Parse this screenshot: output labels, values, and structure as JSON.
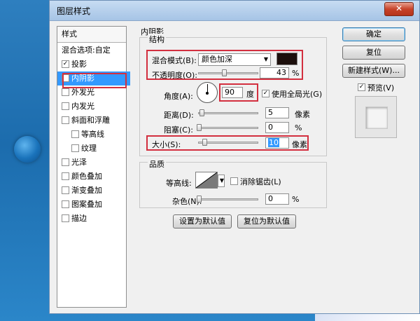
{
  "window": {
    "title": "图层样式",
    "close_glyph": "✕"
  },
  "styles": {
    "header": "样式",
    "items": [
      {
        "label": "混合选项:自定",
        "checkbox": false,
        "checked": false
      },
      {
        "label": "投影",
        "checkbox": true,
        "checked": true
      },
      {
        "label": "内阴影",
        "checkbox": true,
        "checked": true,
        "selected": true
      },
      {
        "label": "外发光",
        "checkbox": true,
        "checked": false
      },
      {
        "label": "内发光",
        "checkbox": true,
        "checked": false
      },
      {
        "label": "斜面和浮雕",
        "checkbox": true,
        "checked": false
      },
      {
        "label": "等高线",
        "checkbox": true,
        "checked": false,
        "sub": true
      },
      {
        "label": "纹理",
        "checkbox": true,
        "checked": false,
        "sub": true
      },
      {
        "label": "光泽",
        "checkbox": true,
        "checked": false
      },
      {
        "label": "颜色叠加",
        "checkbox": true,
        "checked": false
      },
      {
        "label": "渐变叠加",
        "checkbox": true,
        "checked": false
      },
      {
        "label": "图案叠加",
        "checkbox": true,
        "checked": false
      },
      {
        "label": "描边",
        "checkbox": true,
        "checked": false
      }
    ]
  },
  "inner_shadow": {
    "title": "内阴影",
    "structure": {
      "title": "结构",
      "blend_mode_label": "混合模式(B):",
      "blend_mode_value": "颜色加深",
      "shadow_color": "#1c0f0c",
      "opacity_label": "不透明度(O):",
      "opacity_value": "43",
      "opacity_level": 0.43,
      "percent": "%",
      "angle_label": "角度(A):",
      "angle_value": "90",
      "angle_unit": "度",
      "global_light_label": "使用全局光(G)",
      "global_light_checked": true,
      "distance_label": "距离(D):",
      "distance_value": "5",
      "distance_unit": "像素",
      "choke_label": "阻塞(C):",
      "choke_value": "0",
      "choke_unit": "%",
      "size_label": "大小(S):",
      "size_value": "10",
      "size_unit": "像素"
    },
    "quality": {
      "title": "品质",
      "contour_label": "等高线:",
      "anti_alias_label": "消除锯齿(L)",
      "anti_alias_checked": false,
      "noise_label": "杂色(N):",
      "noise_value": "0",
      "noise_unit": "%"
    },
    "set_default_label": "设置为默认值",
    "reset_default_label": "复位为默认值"
  },
  "buttons": {
    "ok": "确定",
    "reset": "复位",
    "new_style": "新建样式(W)...",
    "preview_label": "预览(V)",
    "preview_checked": true
  },
  "colors": {
    "selection": "#3399ff",
    "highlight_box": "#d32f3f",
    "desktop_blue": "#1c6cad"
  }
}
